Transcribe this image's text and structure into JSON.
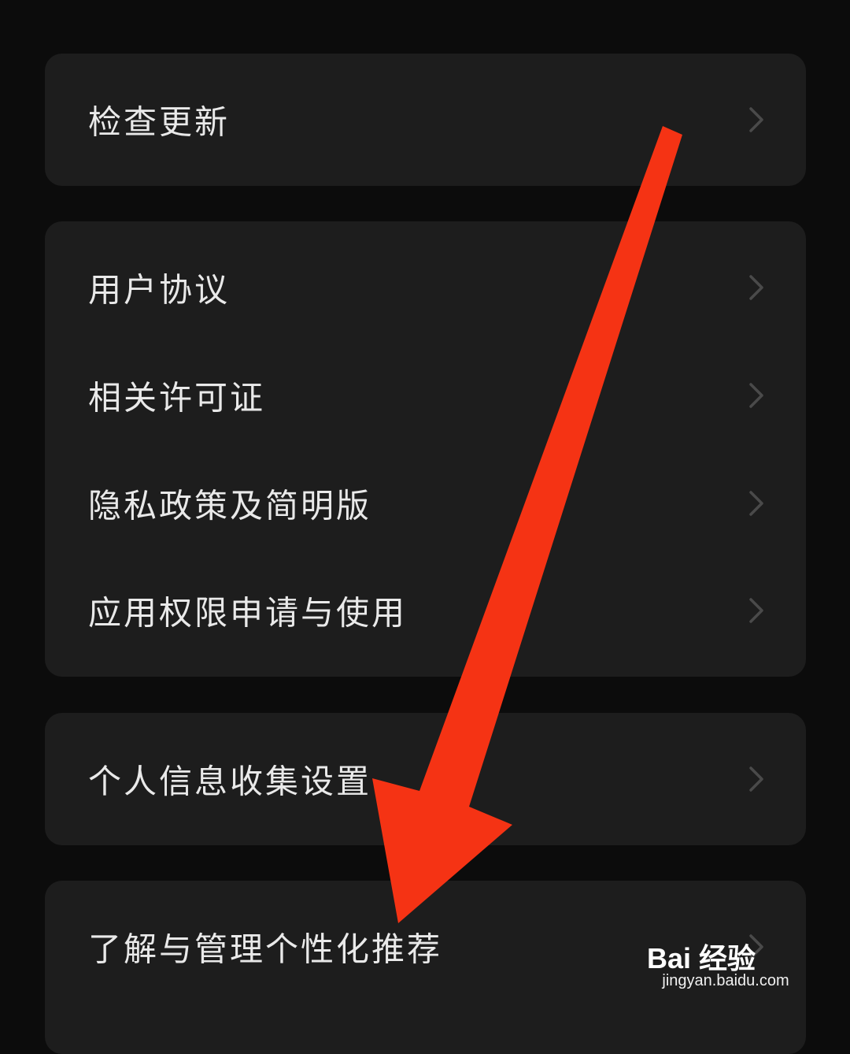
{
  "settings": {
    "group1": [
      {
        "label": "检查更新"
      }
    ],
    "group2": [
      {
        "label": "用户协议"
      },
      {
        "label": "相关许可证"
      },
      {
        "label": "隐私政策及简明版"
      },
      {
        "label": "应用权限申请与使用"
      }
    ],
    "group3": [
      {
        "label": "个人信息收集设置"
      }
    ],
    "group4": [
      {
        "label": "了解与管理个性化推荐"
      }
    ]
  },
  "icons": {
    "chevron": "chevron-right-icon",
    "annotation": "red-arrow-icon"
  },
  "colors": {
    "background": "#0c0c0c",
    "card": "#1d1d1d",
    "text": "#e9e9e9",
    "chevron": "#4a4a4a",
    "arrow": "#f53314"
  },
  "watermark": {
    "brand": "Bai 经验",
    "url": "jingyan.baidu.com"
  }
}
